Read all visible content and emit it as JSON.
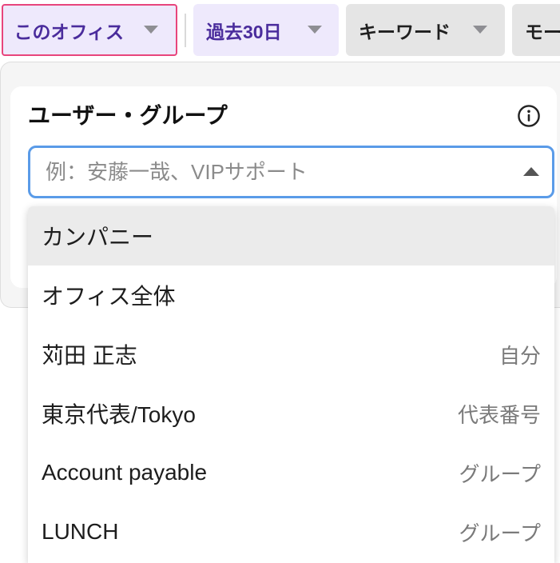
{
  "filters": {
    "chips": [
      {
        "label": "このオフィス",
        "selected": true,
        "focused": true,
        "icon": "chevron-down-icon"
      },
      {
        "label": "過去30日",
        "selected": true,
        "focused": false,
        "icon": "chevron-down-icon"
      },
      {
        "label": "キーワード",
        "selected": false,
        "focused": false,
        "icon": "chevron-down-icon"
      },
      {
        "label": "モー",
        "selected": false,
        "focused": false
      }
    ]
  },
  "user_group_panel": {
    "title": "ユーザー・グループ",
    "info_icon": "info-icon",
    "search": {
      "value": "",
      "placeholder": "例：安藤一哉、VIPサポート",
      "toggle_icon": "caret-up-icon",
      "expanded": true
    },
    "options": [
      {
        "label": "カンパニー",
        "highlighted": true
      },
      {
        "label": "オフィス全体"
      },
      {
        "label": "苅田 正志",
        "tag": "自分"
      },
      {
        "label": "東京代表/Tokyo",
        "tag": "代表番号"
      },
      {
        "label": "Account payable",
        "tag": "グループ"
      },
      {
        "label": "LUNCH",
        "tag": "グループ"
      }
    ]
  },
  "colors": {
    "focus_ring": "#E8457C",
    "chip_selected_bg": "#EEE9FC",
    "chip_selected_text": "#4A2C9C",
    "chip_default_bg": "#E5E5E5",
    "chip_default_text": "#1F1F1F",
    "caret": "#8E8E93",
    "input_border": "#5A9BE8",
    "option_highlight_bg": "#EBEBEB",
    "tag_text": "#7A7A7A"
  }
}
